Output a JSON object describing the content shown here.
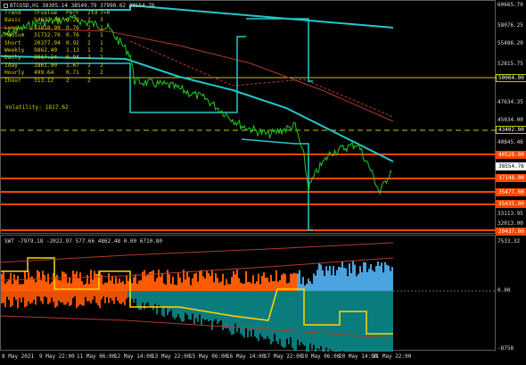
{
  "chart": {
    "title": "BTCUSD,H1 38305.14 38549.79 37998.62 38554.76",
    "symbol_icon": "chart-window-icon"
  },
  "info_table": {
    "headers": [
      "Trend",
      "TFvalue",
      "PerF",
      "2td",
      "7=0"
    ],
    "rows": [
      [
        "Basic",
        "54637.30",
        "0.29",
        "2",
        "3"
      ],
      [
        "Long",
        "53818.90",
        "0.76",
        "2",
        "1"
      ],
      [
        "Medium",
        "31732.76",
        "0.76",
        "2",
        "1"
      ],
      [
        "Short",
        "20377.94",
        "0.92",
        "2",
        "1"
      ],
      [
        "Weekly",
        "9862.40",
        "1.13",
        "1",
        "2"
      ],
      [
        "Daily",
        "3917.24",
        "0.94",
        "2",
        "2"
      ],
      [
        "Iday",
        "1861.90",
        "1.67",
        "2",
        "2"
      ],
      [
        "Hourly",
        "499.64",
        "0.71",
        "2",
        "2"
      ],
      [
        "Ihour",
        "313.12",
        "2",
        "2",
        ""
      ]
    ],
    "volatility": "Volatility: 1817.62"
  },
  "price_axis": {
    "labels": [
      "60665.70",
      "58076.25",
      "55486.20",
      "52815.75",
      "50004.00",
      "47634.35",
      "45034.00",
      "43402.00",
      "40845.46",
      "40528.00",
      "38554.76",
      "37148.00",
      "35477.00",
      "35435.00",
      "33113.95",
      "32013.00",
      "29437.00"
    ],
    "tags": [
      {
        "text": "50004.00",
        "bg": "#000000",
        "border": "#c8c800",
        "color": "#ffffff"
      },
      {
        "text": "43402.00",
        "bg": "#000000",
        "border": "#c8c800",
        "color": "#ffffff"
      },
      {
        "text": "40528.00",
        "bg": "#ff4500",
        "border": "#ff4500",
        "color": "#ffffff"
      },
      {
        "text": "38554.76",
        "bg": "#ffffff",
        "border": "#ffffff",
        "color": "#000000"
      },
      {
        "text": "37148.00",
        "bg": "#ff4500",
        "border": "#ff4500",
        "color": "#ffffff"
      },
      {
        "text": "35477.00",
        "bg": "#ff4500",
        "border": "#ff4500",
        "color": "#ffffff"
      },
      {
        "text": "35435.00",
        "bg": "#ff4500",
        "border": "#ff4500",
        "color": "#ffffff"
      },
      {
        "text": "29437.00",
        "bg": "#ff4500",
        "border": "#ff4500",
        "color": "#ffffff"
      }
    ]
  },
  "sub_window": {
    "title": "SWT -7979.18 -2022.97 577.66 4862.48 0.00 6710.80",
    "axis_labels": [
      "7533.32",
      "0.00",
      "-8758"
    ]
  },
  "time_axis": {
    "labels": [
      "8 May 2021",
      "9 May 22:00",
      "11 May 06:00",
      "12 May 14:00",
      "13 May 22:00",
      "15 May 06:00",
      "16 May 14:00",
      "17 May 22:00",
      "19 May 06:00",
      "20 May 14:00",
      "21 May 22:00"
    ]
  },
  "colors": {
    "price": "#22cc22",
    "ma_fast": "#22c8c8",
    "ma_slow": "#b03a2e",
    "level_yellow": "#c8c800",
    "level_red": "#ff4500",
    "hist_orange": "#ff5a00",
    "hist_blue": "#4aa3df",
    "hist_teal": "#0c8a8a",
    "signal_yellow": "#ffd700"
  }
}
